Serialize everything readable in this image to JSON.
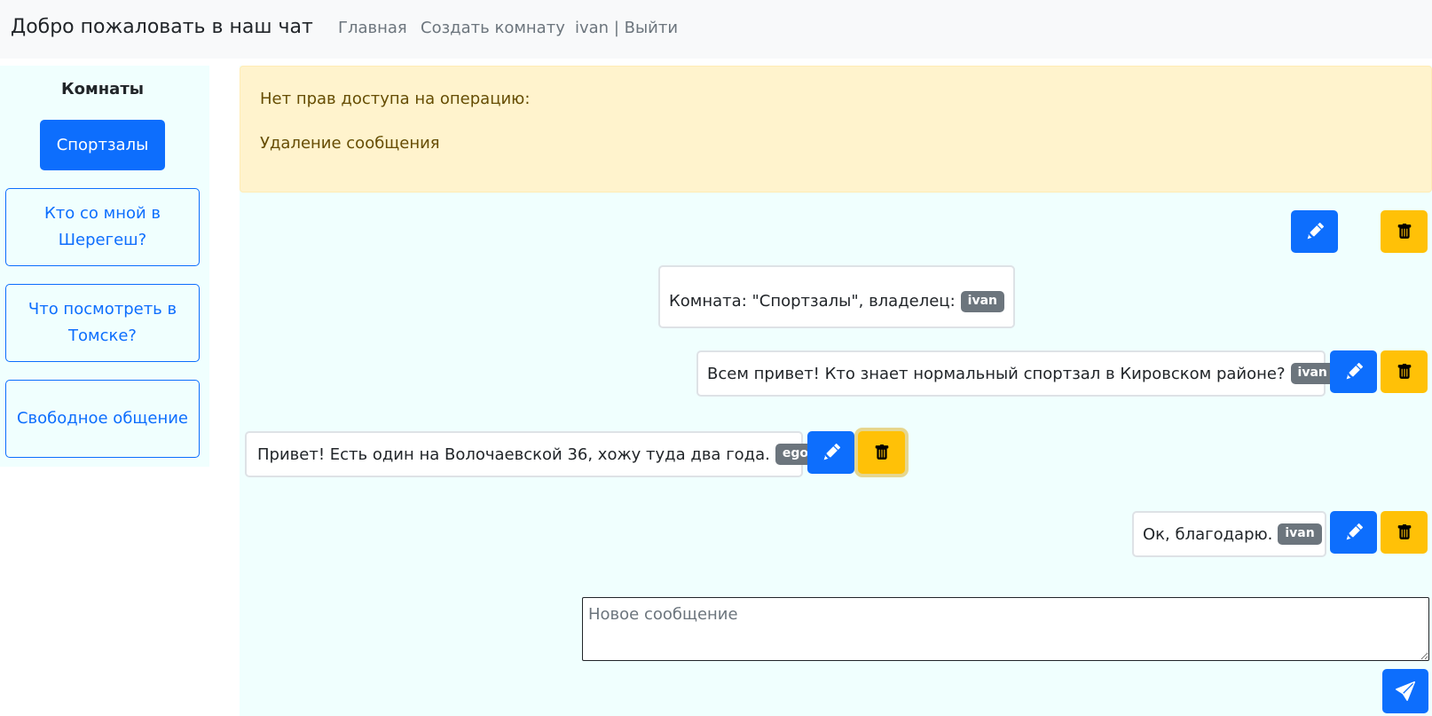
{
  "navbar": {
    "brand": "Добро пожаловать в наш чат",
    "home": "Главная",
    "create_room": "Создать комнату",
    "user_logout": "ivan | Выйти"
  },
  "sidebar": {
    "title": "Комнаты",
    "rooms": [
      {
        "label": "Спортзалы",
        "active": true
      },
      {
        "label": "Кто со мной в Шерегеш?",
        "active": false
      },
      {
        "label": "Что посмотреть в Томске?",
        "active": false
      },
      {
        "label": "Свободное общение",
        "active": false
      }
    ]
  },
  "alert": {
    "line1": "Нет прав доступа на операцию:",
    "line2": "Удаление сообщения",
    "color": "#fff3cd"
  },
  "room_info": {
    "text": "Комната: \"Спортзалы\", владелец:",
    "owner": "ivan"
  },
  "messages": [
    {
      "text": "Всем привет! Кто знает нормальный спортзал в Кировском районе?",
      "author": "ivan"
    },
    {
      "text": "Привет! Есть один на Волочаевской 36, хожу туда два года.",
      "author": "egor"
    },
    {
      "text": "Ок, благодарю.",
      "author": "ivan"
    }
  ],
  "composer": {
    "placeholder": "Новое сообщение"
  },
  "icons": {
    "edit": "pencil-icon",
    "delete": "trash-icon",
    "send": "send-icon"
  },
  "colors": {
    "primary": "#0d6efd",
    "warning": "#ffc107",
    "badge": "#6c757d",
    "chat_background": "#f0fffe"
  }
}
